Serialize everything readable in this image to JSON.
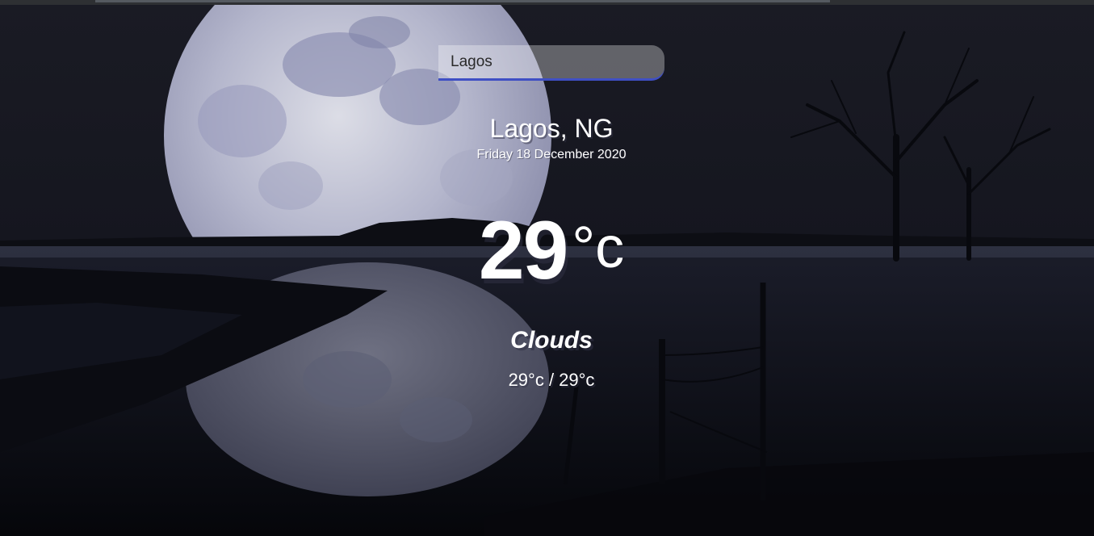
{
  "search": {
    "value": "Lagos"
  },
  "location": {
    "city_country": "Lagos, NG",
    "date": "Friday 18 December 2020"
  },
  "weather": {
    "temperature": "29",
    "unit": "°c",
    "condition": "Clouds",
    "hi_low": "29°c / 29°c"
  },
  "colors": {
    "accent": "#3f4fc4",
    "text": "#ffffff",
    "background": "#0b0c12"
  },
  "background_image": {
    "icon": "night-moon-lake-background"
  }
}
